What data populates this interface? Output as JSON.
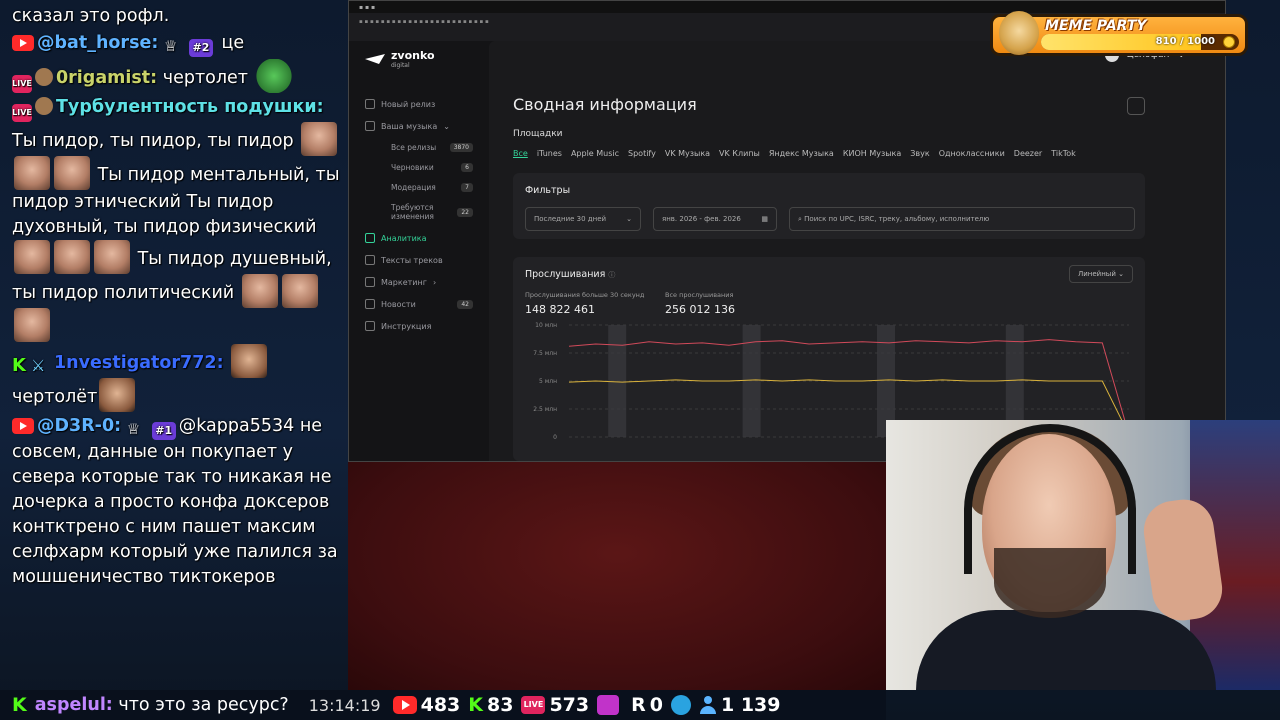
{
  "chat": {
    "m0": {
      "text": "сказал это рофл."
    },
    "m1": {
      "nick": "@bat_horse:",
      "rank": "#2",
      "text": "це",
      "color": "#5fb3ff"
    },
    "m2": {
      "nick": "0rigamist:",
      "text": "чертолет",
      "color": "#c9d36a"
    },
    "m3": {
      "nick": "Турбулентность подушки:",
      "text1": "Ты пидор, ты пидор, ты пидор",
      "text2": "Ты пидор ментальный, ты пидор этнический Ты пидор духовный, ты пидор физический",
      "text3": "Ты пидор душевный, ты пидор политический",
      "color": "#5ee1e6"
    },
    "m4": {
      "nick": "1nvestigator772:",
      "text": "чертолёт",
      "color": "#3a6cff"
    },
    "m5": {
      "nick": "@D3R-0:",
      "rank": "#1",
      "mention": "@kappa5534",
      "text": "не совсем, данные он покупает у севера которые так то никакая не дочерка а просто конфа доксеров контктрено с ним пашет максим селфхарм который уже палился за мошшеничество тиктокеров",
      "color": "#5fb3ff"
    }
  },
  "statsbar": {
    "last_nick": "aspelul:",
    "last_text": "что это за ресурс?",
    "time": "13:14:19",
    "youtube": "483",
    "kick": "83",
    "vk": "573",
    "twitch": "",
    "rutube": "0",
    "total": "1 139"
  },
  "meme": {
    "title": "MEME PARTY",
    "value": "810 / 1000",
    "progress": 0.81
  },
  "screen": {
    "user": "Целофан",
    "logo": "zvonko",
    "logo_sub": "digital",
    "nav": {
      "new_release": "Новый релиз",
      "your_music": "Ваша музыка",
      "all_releases": "Все релизы",
      "all_count": "3870",
      "drafts": "Черновики",
      "drafts_count": "6",
      "moderation": "Модерация",
      "moderation_count": "7",
      "need_changes": "Требуются изменения",
      "need_changes_count": "22",
      "analytics": "Аналитика",
      "lyrics": "Тексты треков",
      "marketing": "Маркетинг",
      "news": "Новости",
      "news_count": "42",
      "instruction": "Инструкция"
    },
    "title": "Сводная информация",
    "platforms_label": "Площадки",
    "platforms": [
      "Все",
      "iTunes",
      "Apple Music",
      "Spotify",
      "VK Музыка",
      "VK Клипы",
      "Яндекс Музыка",
      "КИОН Музыка",
      "Звук",
      "Одноклассники",
      "Deezer",
      "TikTok"
    ],
    "filters": {
      "title": "Фильтры",
      "period": "Последние 30 дней",
      "dates": "янв. 2026 - фев. 2026",
      "search_placeholder": "Поиск по UPC, ISRC, треку, альбому, исполнителю"
    },
    "listens": {
      "title": "Прослушивания",
      "mode": "Линейный",
      "stat1_label": "Прослушивания больше 30 секунд",
      "stat1_value": "148 822 461",
      "stat2_label": "Все прослушивания",
      "stat2_value": "256 012 136"
    }
  },
  "chart_data": {
    "type": "line",
    "y_ticks": [
      "10 млн",
      "7.5 млн",
      "5 млн",
      "2.5 млн",
      "0"
    ],
    "ylim": [
      0,
      10
    ],
    "series": [
      {
        "color": "#d14a5a",
        "values": [
          8.1,
          8.3,
          8.2,
          8.5,
          8.3,
          8.4,
          8.2,
          8.5,
          8.6,
          8.3,
          8.4,
          8.5,
          8.4,
          8.6,
          8.5,
          8.4,
          8.6,
          8.5,
          8.7,
          8.5,
          8.4,
          0.2
        ]
      },
      {
        "color": "#d9b23c",
        "values": [
          4.9,
          5.0,
          4.9,
          5.0,
          5.1,
          5.0,
          5.0,
          5.1,
          5.0,
          5.1,
          5.0,
          5.0,
          5.1,
          5.0,
          5.1,
          5.0,
          5.0,
          5.1,
          5.0,
          5.0,
          5.0,
          0.2
        ]
      }
    ]
  }
}
